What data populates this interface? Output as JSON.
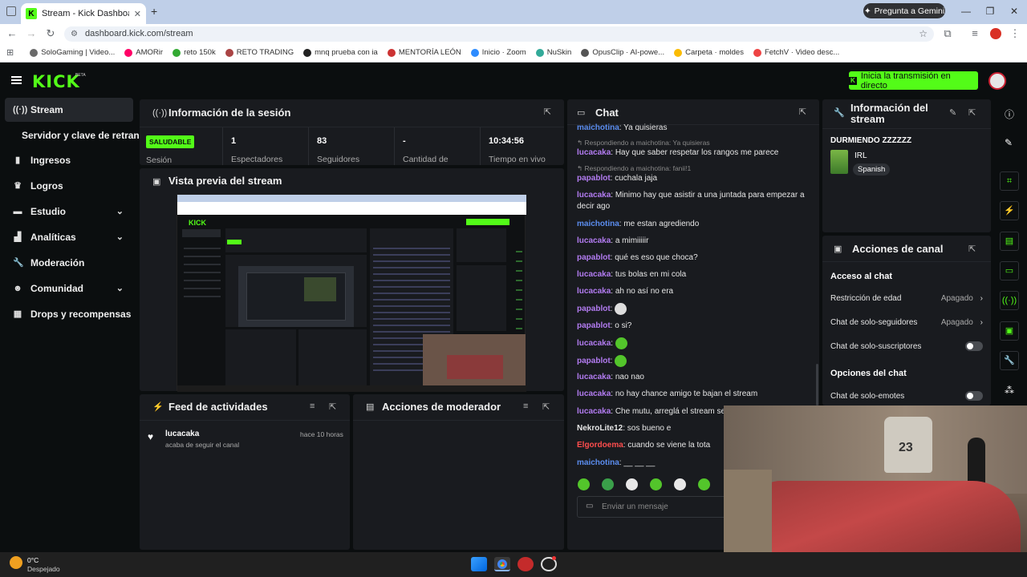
{
  "browser": {
    "tab_title": "Stream - Kick Dashboard",
    "gemini_label": "Pregunta a Gemini",
    "url": "dashboard.kick.com/stream",
    "bookmarks": [
      "SoloGaming | Video...",
      "AMORir",
      "reto 150k",
      "RETO TRADING",
      "mnq prueba con ia",
      "MENTORÍA LEÓN",
      "Inicio · Zoom",
      "NuSkin",
      "OpusClip · AI-powe...",
      "Carpeta · moldes",
      "FetchV · Video desc..."
    ]
  },
  "header": {
    "logo": "KICK",
    "beta": "BETA",
    "golive_label": "Inicia la transmisión en directo"
  },
  "sidebar": {
    "items": [
      {
        "label": "Stream"
      },
      {
        "label": "Servidor y clave de retransmisión"
      },
      {
        "label": "Ingresos"
      },
      {
        "label": "Logros"
      },
      {
        "label": "Estudio"
      },
      {
        "label": "Analíticas"
      },
      {
        "label": "Moderación"
      },
      {
        "label": "Comunidad"
      },
      {
        "label": "Drops y recompensas"
      }
    ]
  },
  "session": {
    "title": "Información de la sesión",
    "status": "SALUDABLE",
    "status_label": "Sesión",
    "stats": [
      {
        "value": "1",
        "label": "Espectadores"
      },
      {
        "value": "83",
        "label": "Seguidores"
      },
      {
        "value": "-",
        "label": "Cantidad de"
      },
      {
        "value": "10:34:56",
        "label": "Tiempo en vivo"
      }
    ]
  },
  "preview": {
    "title": "Vista previa del stream"
  },
  "activity": {
    "title": "Feed de actividades",
    "item_user": "lucacaka",
    "item_text": "acaba de seguir el canal",
    "item_time": "hace 10 horas"
  },
  "moderator": {
    "title": "Acciones de moderador"
  },
  "chat": {
    "title": "Chat",
    "messages": [
      {
        "user": "maichotina",
        "color": "#5b8def",
        "text": ": Ya quisieras"
      },
      {
        "reply": "Respondiendo a maichotina: Ya quisieras"
      },
      {
        "user": "lucacaka",
        "color": "#b37cf2",
        "text": ": Hay que saber respetar los rangos me parece"
      },
      {
        "reply": "Respondiendo a maichotina: fanii!1"
      },
      {
        "user": "papablot",
        "color": "#b37cf2",
        "text": ": cuchala jaja"
      },
      {
        "user": "lucacaka",
        "color": "#b37cf2",
        "text": ": Minimo hay que asistir a una juntada para empezar a decir ago"
      },
      {
        "user": "maichotina",
        "color": "#5b8def",
        "text": ": me estan agrediendo"
      },
      {
        "user": "lucacaka",
        "color": "#b37cf2",
        "text": ": a mimiiiiir"
      },
      {
        "user": "papablot",
        "color": "#b37cf2",
        "text": ": qué es eso que choca?"
      },
      {
        "user": "lucacaka",
        "color": "#b37cf2",
        "text": ": tus bolas en mi cola"
      },
      {
        "user": "lucacaka",
        "color": "#b37cf2",
        "text": ": ah no así no era"
      },
      {
        "user": "papablot",
        "color": "#b37cf2",
        "text": ":"
      },
      {
        "user": "papablot",
        "color": "#b37cf2",
        "text": ": o si?"
      },
      {
        "user": "lucacaka",
        "color": "#b37cf2",
        "text": ":"
      },
      {
        "user": "papablot",
        "color": "#b37cf2",
        "text": ":"
      },
      {
        "user": "lucacaka",
        "color": "#b37cf2",
        "text": ": nao nao"
      },
      {
        "user": "lucacaka",
        "color": "#b37cf2",
        "text": ": no hay chance amigo te bajan el stream"
      },
      {
        "user": "lucacaka",
        "color": "#b37cf2",
        "text": ": Che mutu, arreglá el stream se"
      },
      {
        "user": "NekroLite12",
        "color": "#e6e6e6",
        "text": ": sos bueno e"
      },
      {
        "user": "Elgordoema",
        "color": "#ff4d4d",
        "text": ": cuando se viene la tota"
      },
      {
        "user": "maichotina",
        "color": "#5b8def",
        "text": ": __ __ __"
      }
    ],
    "input_placeholder": "Enviar un mensaje"
  },
  "stream_info": {
    "title": "Información del stream",
    "stream_title": "DURMIENDO ZZZZZZ",
    "category": "IRL",
    "language": "Spanish"
  },
  "channel_actions": {
    "title": "Acciones de canal",
    "access_title": "Acceso al chat",
    "rows": [
      {
        "label": "Restricción de edad",
        "value": "Apagado"
      },
      {
        "label": "Chat de solo-seguidores",
        "value": "Apagado"
      },
      {
        "label": "Chat de solo-suscriptores"
      }
    ],
    "options_title": "Opciones del chat",
    "option_row": "Chat de solo-emotes"
  },
  "taskbar": {
    "temp": "0°C",
    "weather": "Despejado"
  }
}
